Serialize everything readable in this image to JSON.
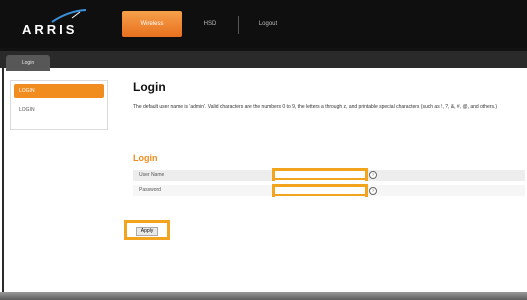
{
  "brand": {
    "logo_text": "ARRIS"
  },
  "nav": {
    "tabs": [
      {
        "label": "Wireless",
        "active": true
      },
      {
        "label": "HSD",
        "active": false
      },
      {
        "label": "Logout",
        "active": false
      }
    ]
  },
  "subnav": {
    "tab_label": "Login"
  },
  "sidebar": {
    "items": [
      {
        "label": "LOGIN",
        "active": true
      },
      {
        "label": "LOGIN",
        "active": false
      }
    ]
  },
  "main": {
    "title": "Login",
    "description": "The default user name is 'admin'. Valid characters are the numbers 0 to 9, the letters a through z, and printable special characters (such as !, ?, &, #, @, and others.)",
    "section_title": "Login",
    "form": {
      "username_label": "User Name",
      "username_value": "",
      "password_label": "Password",
      "password_value": "",
      "help_glyph": "?"
    },
    "apply_label": "Apply"
  },
  "colors": {
    "accent": "#f18d1e",
    "highlight_outline": "#f2a41f",
    "topbar": "#0f0f0f"
  }
}
